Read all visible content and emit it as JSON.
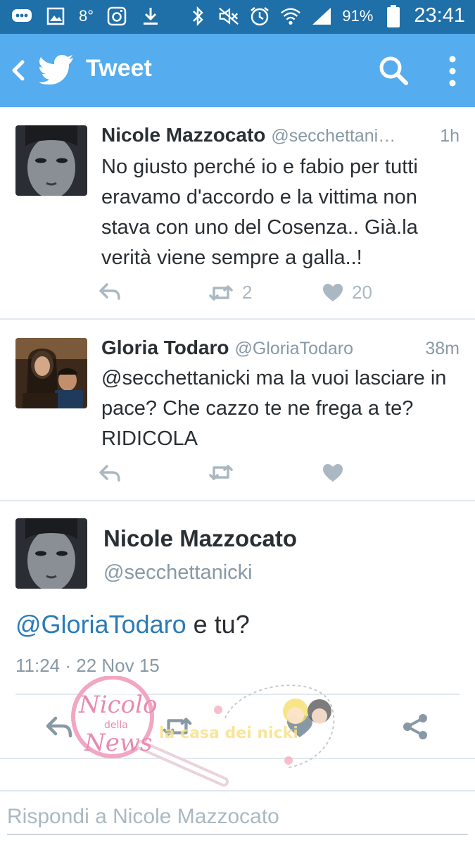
{
  "statusbar": {
    "left_icons": [
      "bbm-icon",
      "gallery-icon",
      "temperature-icon",
      "instagram-icon",
      "download-icon"
    ],
    "temperature": "8°",
    "right_icons": [
      "bluetooth-icon",
      "mute-icon",
      "alarm-icon",
      "wifi-icon",
      "signal-icon"
    ],
    "battery": "91%",
    "time": "23:41"
  },
  "appbar": {
    "title": "Tweet",
    "color": "#55acee"
  },
  "tweets": [
    {
      "name": "Nicole Mazzocato",
      "handle": "@secchettani…",
      "time": "1h",
      "text": "No giusto perché io e fabio per tutti eravamo d'accordo e la vittima non stava con uno del Cosenza.. Già.la verità viene sempre a galla..!",
      "retweets": "2",
      "likes": "20"
    },
    {
      "name": "Gloria Todaro",
      "handle": "@GloriaTodaro",
      "time": "38m",
      "text": "@secchettanicki ma la vuoi lasciare in pace? Che cazzo te ne frega a te? RIDICOLA",
      "retweets": "",
      "likes": ""
    }
  ],
  "detail": {
    "name": "Nicole Mazzocato",
    "handle": "@secchettanicki",
    "mention": "@GloriaTodaro",
    "text_rest": " e tu?",
    "meta": "11:24 · 22 Nov 15"
  },
  "watermark": {
    "left": "Nicolo della News",
    "right": "la casa dei nicki"
  },
  "reply": {
    "placeholder": "Rispondi a Nicole Mazzocato"
  },
  "colors": {
    "status_bar": "#1f6fa8",
    "accent": "#55acee",
    "link": "#2b7bb9",
    "muted": "#8899a6",
    "icon": "#aab8c2"
  }
}
